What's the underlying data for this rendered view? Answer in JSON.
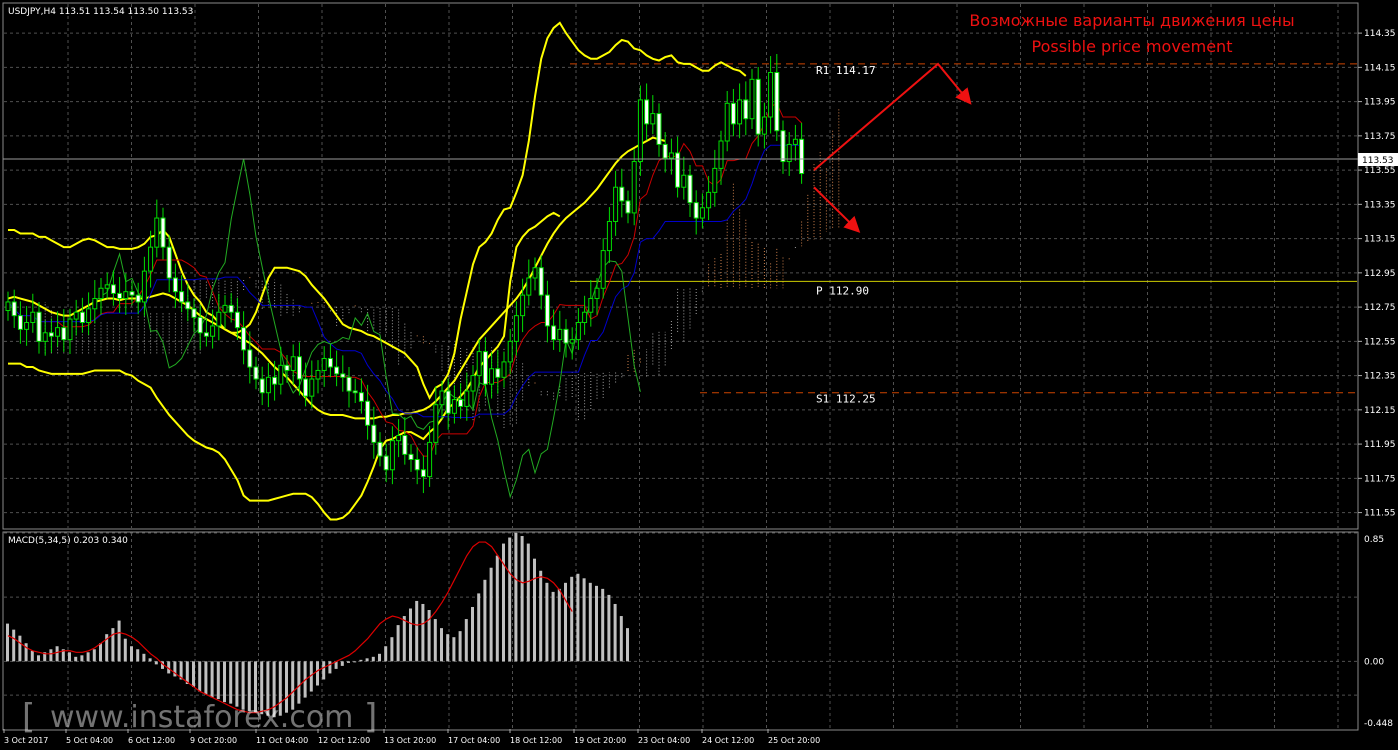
{
  "main": {
    "symbol_info": "USDJPY,H4  113.51 113.54 113.50 113.53",
    "annotation_ru": "Возможные варианты движения цены",
    "annotation_en": "Possible price movement",
    "current_price": "113.53"
  },
  "macd": {
    "label": "MACD(5,34,5) 0.203 0.340"
  },
  "watermark": "www.instaforex.com",
  "colors": {
    "background": "#000000",
    "grid": "#505050",
    "candle": "#00dd00",
    "bollinger": "#ffff00",
    "tenkan": "#cc0000",
    "kijun": "#0000cc",
    "chikou": "#22aa22",
    "cloud_up": "#ffa060",
    "cloud_down": "#c8c8c8",
    "pivot_r": "#cc4400",
    "pivot_p": "#cccc00",
    "pivot_s": "#cc4400",
    "arrow": "#ee1111",
    "histogram": "#c0c0c0",
    "signal": "#dd0000"
  },
  "chart_data": [
    {
      "type": "candlestick",
      "title": "USDJPY,H4",
      "ylim": [
        111.46,
        114.52
      ],
      "y_ticks": [
        "114.35",
        "114.15",
        "113.95",
        "113.75",
        "113.55",
        "113.35",
        "113.15",
        "112.95",
        "112.75",
        "112.55",
        "112.35",
        "112.15",
        "111.95",
        "111.75",
        "111.55"
      ],
      "x_ticks": [
        "3 Oct 2017",
        "5 Oct 04:00",
        "6 Oct 12:00",
        "9 Oct 20:00",
        "11 Oct 04:00",
        "12 Oct 12:00",
        "13 Oct 20:00",
        "17 Oct 04:00",
        "18 Oct 12:00",
        "19 Oct 20:00",
        "23 Oct 04:00",
        "24 Oct 12:00",
        "25 Oct 20:00"
      ],
      "grid": true,
      "close": [
        112.78,
        112.7,
        112.62,
        112.66,
        112.72,
        112.55,
        112.6,
        112.58,
        112.63,
        112.56,
        112.68,
        112.72,
        112.66,
        112.74,
        112.8,
        112.86,
        112.88,
        112.83,
        112.8,
        112.84,
        112.82,
        112.78,
        112.96,
        113.1,
        113.27,
        113.1,
        112.92,
        112.84,
        112.78,
        112.74,
        112.69,
        112.6,
        112.58,
        112.64,
        112.72,
        112.76,
        112.72,
        112.63,
        112.5,
        112.4,
        112.33,
        112.25,
        112.34,
        112.3,
        112.41,
        112.38,
        112.46,
        112.33,
        112.23,
        112.33,
        112.38,
        112.45,
        112.4,
        112.36,
        112.34,
        112.26,
        112.25,
        112.2,
        112.06,
        111.96,
        111.88,
        111.8,
        111.97,
        112.0,
        111.89,
        111.86,
        111.8,
        111.76,
        111.96,
        112.18,
        112.26,
        112.13,
        112.21,
        112.17,
        112.26,
        112.35,
        112.49,
        112.3,
        112.39,
        112.34,
        112.43,
        112.55,
        112.7,
        112.82,
        112.92,
        112.98,
        112.82,
        112.64,
        112.56,
        112.62,
        112.54,
        112.56,
        112.66,
        112.72,
        112.8,
        112.86,
        113.08,
        113.25,
        113.45,
        113.37,
        113.3,
        113.6,
        113.96,
        113.82,
        113.88,
        113.7,
        113.62,
        113.65,
        113.45,
        113.52,
        113.36,
        113.27,
        113.33,
        113.42,
        113.56,
        113.72,
        113.94,
        113.82,
        113.96,
        113.85,
        114.08,
        113.76,
        113.86,
        114.12,
        113.78,
        113.6,
        113.7,
        113.73,
        113.53
      ],
      "bollinger": {
        "upper": [
          113.2,
          113.2,
          113.18,
          113.18,
          113.18,
          113.16,
          113.16,
          113.14,
          113.12,
          113.1,
          113.1,
          113.12,
          113.14,
          113.15,
          113.14,
          113.12,
          113.1,
          113.1,
          113.09,
          113.09,
          113.09,
          113.1,
          113.12,
          113.16,
          113.17,
          113.2,
          113.16,
          113.06,
          112.96,
          112.88,
          112.82,
          112.78,
          112.72,
          112.7,
          112.66,
          112.62,
          112.6,
          112.6,
          112.62,
          112.65,
          112.72,
          112.82,
          112.92,
          112.98,
          112.98,
          112.98,
          112.97,
          112.96,
          112.93,
          112.88,
          112.84,
          112.8,
          112.75,
          112.7,
          112.65,
          112.63,
          112.62,
          112.61,
          112.59,
          112.58,
          112.56,
          112.54,
          112.52,
          112.5,
          112.48,
          112.44,
          112.4,
          112.3,
          112.22,
          112.28,
          112.3,
          112.36,
          112.48,
          112.68,
          112.84,
          113.0,
          113.1,
          113.13,
          113.18,
          113.26,
          113.32,
          113.33,
          113.42,
          113.52,
          113.72,
          113.98,
          114.2,
          114.32,
          114.38,
          114.41,
          114.35,
          114.3,
          114.25,
          114.22,
          114.2,
          114.2,
          114.22,
          114.24,
          114.28,
          114.31,
          114.3,
          114.26,
          114.25,
          114.22,
          114.2,
          114.19,
          114.21,
          114.22,
          114.18,
          114.17,
          114.17,
          114.15,
          114.13,
          114.13,
          114.16,
          114.18,
          114.16,
          114.14,
          114.13,
          114.1
        ],
        "middle": [
          112.8,
          112.81,
          112.8,
          112.79,
          112.78,
          112.76,
          112.74,
          112.72,
          112.71,
          112.7,
          112.7,
          112.72,
          112.74,
          112.76,
          112.78,
          112.79,
          112.8,
          112.8,
          112.79,
          112.8,
          112.8,
          112.8,
          112.8,
          112.81,
          112.82,
          112.83,
          112.82,
          112.8,
          112.78,
          112.76,
          112.73,
          112.7,
          112.68,
          112.66,
          112.64,
          112.62,
          112.6,
          112.58,
          112.56,
          112.54,
          112.51,
          112.48,
          112.44,
          112.4,
          112.37,
          112.34,
          112.3,
          112.26,
          112.22,
          112.18,
          112.15,
          112.13,
          112.12,
          112.12,
          112.12,
          112.11,
          112.1,
          112.1,
          112.1,
          112.1,
          112.11,
          112.11,
          112.12,
          112.12,
          112.13,
          112.13,
          112.14,
          112.15,
          112.17,
          112.2,
          112.24,
          112.28,
          112.32,
          112.38,
          112.44,
          112.5,
          112.56,
          112.6,
          112.64,
          112.68,
          112.72,
          112.76,
          112.8,
          112.85,
          112.91,
          112.98,
          113.05,
          113.12,
          113.18,
          113.23,
          113.27,
          113.3,
          113.33,
          113.36,
          113.4,
          113.44,
          113.49,
          113.54,
          113.59,
          113.63,
          113.66,
          113.68,
          113.7,
          113.72,
          113.74,
          113.73,
          113.72
        ],
        "lower": [
          112.42,
          112.42,
          112.42,
          112.4,
          112.4,
          112.38,
          112.37,
          112.36,
          112.36,
          112.36,
          112.36,
          112.36,
          112.36,
          112.37,
          112.38,
          112.38,
          112.38,
          112.38,
          112.38,
          112.36,
          112.35,
          112.32,
          112.3,
          112.28,
          112.22,
          112.17,
          112.12,
          112.08,
          112.04,
          112.0,
          111.97,
          111.95,
          111.93,
          111.92,
          111.9,
          111.86,
          111.8,
          111.74,
          111.65,
          111.62,
          111.62,
          111.62,
          111.62,
          111.63,
          111.64,
          111.65,
          111.66,
          111.66,
          111.66,
          111.64,
          111.6,
          111.55,
          111.51,
          111.51,
          111.52,
          111.55,
          111.6,
          111.65,
          111.73,
          111.82,
          111.92,
          111.97,
          111.98,
          112.0,
          112.02,
          112.02,
          112.0,
          111.98,
          112.02,
          112.05,
          112.1,
          112.16,
          112.19,
          112.23,
          112.27,
          112.33,
          112.4,
          112.44,
          112.48,
          112.52,
          112.58,
          112.9,
          113.1,
          113.16,
          113.2,
          113.22,
          113.25,
          113.28,
          113.3,
          113.28
        ]
      },
      "pivot_levels": [
        {
          "label": "R1 114.17",
          "value": 114.17
        },
        {
          "label": "P 112.90",
          "value": 112.9
        },
        {
          "label": "S1 112.25",
          "value": 112.25
        }
      ],
      "projected_paths": {
        "up": [
          [
            130,
            113.55
          ],
          [
            150,
            114.17
          ],
          [
            155,
            113.95
          ]
        ],
        "down": [
          [
            130,
            113.45
          ],
          [
            137,
            113.2
          ]
        ]
      }
    },
    {
      "type": "bar",
      "title": "MACD(5,34,5) 0.203 0.340",
      "ylim": [
        -0.448,
        0.85
      ],
      "y_ticks": [
        "0.85",
        "0.00",
        "-0.448"
      ],
      "histogram": [
        0.25,
        0.21,
        0.17,
        0.12,
        0.07,
        0.04,
        0.06,
        0.08,
        0.1,
        0.08,
        0.06,
        0.03,
        0.04,
        0.06,
        0.08,
        0.12,
        0.18,
        0.22,
        0.27,
        0.15,
        0.1,
        0.08,
        0.05,
        0.02,
        -0.02,
        -0.05,
        -0.08,
        -0.1,
        -0.12,
        -0.15,
        -0.17,
        -0.2,
        -0.22,
        -0.24,
        -0.25,
        -0.27,
        -0.28,
        -0.3,
        -0.32,
        -0.33,
        -0.34,
        -0.35,
        -0.36,
        -0.37,
        -0.36,
        -0.34,
        -0.32,
        -0.28,
        -0.24,
        -0.2,
        -0.16,
        -0.12,
        -0.08,
        -0.05,
        -0.03,
        -0.01,
        0.0,
        0.01,
        0.02,
        0.03,
        0.05,
        0.1,
        0.16,
        0.24,
        0.3,
        0.35,
        0.4,
        0.38,
        0.34,
        0.28,
        0.22,
        0.18,
        0.16,
        0.2,
        0.28,
        0.36,
        0.45,
        0.54,
        0.62,
        0.7,
        0.78,
        0.82,
        0.85,
        0.83,
        0.78,
        0.68,
        0.6,
        0.52,
        0.46,
        0.48,
        0.52,
        0.56,
        0.58,
        0.55,
        0.52,
        0.5,
        0.48,
        0.44,
        0.38,
        0.3,
        0.22
      ],
      "signal": [
        0.17,
        0.15,
        0.12,
        0.09,
        0.07,
        0.06,
        0.05,
        0.05,
        0.06,
        0.07,
        0.07,
        0.06,
        0.06,
        0.07,
        0.09,
        0.12,
        0.15,
        0.18,
        0.19,
        0.18,
        0.16,
        0.13,
        0.09,
        0.05,
        0.02,
        -0.02,
        -0.05,
        -0.08,
        -0.11,
        -0.14,
        -0.17,
        -0.2,
        -0.22,
        -0.24,
        -0.26,
        -0.28,
        -0.3,
        -0.32,
        -0.33,
        -0.34,
        -0.34,
        -0.33,
        -0.32,
        -0.3,
        -0.27,
        -0.24,
        -0.2,
        -0.16,
        -0.12,
        -0.09,
        -0.06,
        -0.04,
        -0.02,
        0.0,
        0.02,
        0.04,
        0.07,
        0.11,
        0.15,
        0.2,
        0.25,
        0.28,
        0.3,
        0.29,
        0.27,
        0.25,
        0.24,
        0.25,
        0.28,
        0.33,
        0.39,
        0.46,
        0.54,
        0.62,
        0.7,
        0.76,
        0.79,
        0.79,
        0.76,
        0.7,
        0.64,
        0.58,
        0.54,
        0.52,
        0.53,
        0.55,
        0.56,
        0.55,
        0.52,
        0.47,
        0.4,
        0.33
      ]
    }
  ]
}
